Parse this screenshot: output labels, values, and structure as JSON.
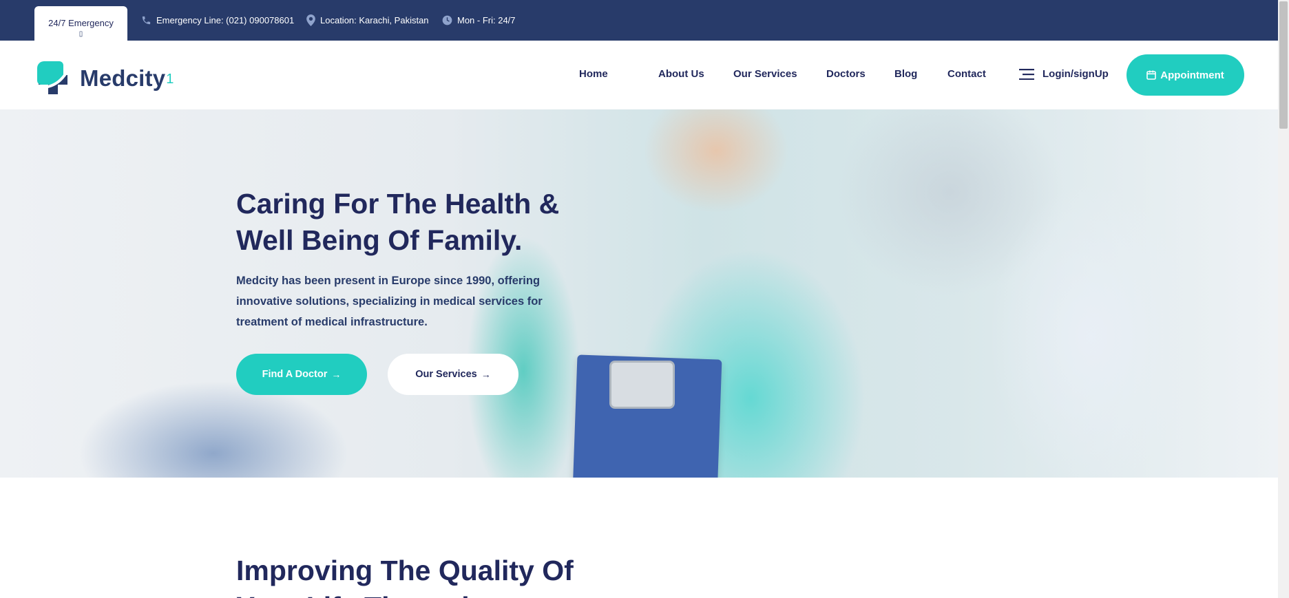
{
  "topbar": {
    "emergency_tab": "24/7 Emergency",
    "emergency_glyph": "▯",
    "phone": "Emergency Line: (021) 090078601",
    "location": "Location: Karachi, Pakistan",
    "hours": "Mon - Fri: 24/7",
    "icons": [
      "phone-icon",
      "location-pin-icon",
      "clock-icon"
    ]
  },
  "header": {
    "logo_text": "Medcity",
    "logo_sup": "1",
    "nav": [
      "Home",
      "About Us",
      "Our Services",
      "Doctors",
      "Blog",
      "Contact"
    ],
    "login_label": "Login/signUp",
    "appointment_label": "Appointment"
  },
  "hero": {
    "title_line1": "Caring For The Health &",
    "title_line2": "Well Being Of Family.",
    "desc_line1": "Medcity has been present in Europe since 1990, offering",
    "desc_line2": "innovative solutions, specializing in medical services for",
    "desc_line3": "treatment of medical infrastructure.",
    "btn_find_doctor": "Find A Doctor",
    "btn_our_services": "Our Services",
    "arrow": "→"
  },
  "section": {
    "title_line1": "Improving The Quality Of",
    "title_line2": "Your Life Through"
  },
  "colors": {
    "navy": "#283b6a",
    "dark_text": "#21285c",
    "accent": "#21cdc0"
  }
}
